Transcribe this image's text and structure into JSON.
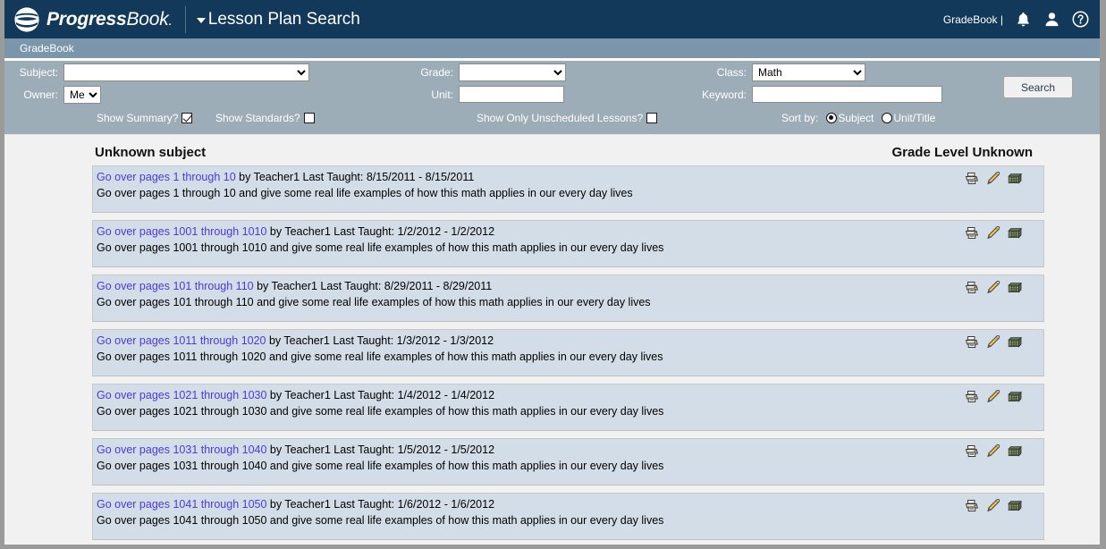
{
  "header": {
    "brand_bold": "Progress",
    "brand_light": "Book",
    "brand_dot": ".",
    "page_title": "Lesson Plan Search",
    "user_label": "GradeBook |",
    "icons": [
      "bell-icon",
      "user-icon",
      "help-icon"
    ],
    "bg_color": "#12395a"
  },
  "tabbar": {
    "tabs": [
      {
        "label": "GradeBook"
      }
    ],
    "bg_color": "#7b95ab"
  },
  "filters": {
    "bg_color": "#9dadb8",
    "subject": {
      "label": "Subject:",
      "value": "",
      "options": [
        ""
      ]
    },
    "owner": {
      "label": "Owner:",
      "value": "Me",
      "options": [
        "Me"
      ]
    },
    "grade": {
      "label": "Grade:",
      "value": "",
      "options": [
        ""
      ]
    },
    "unit": {
      "label": "Unit:",
      "value": "",
      "placeholder": ""
    },
    "class": {
      "label": "Class:",
      "value": "Math",
      "options": [
        "Math"
      ]
    },
    "keyword": {
      "label": "Keyword:",
      "value": "",
      "placeholder": ""
    },
    "search_button": "Search",
    "show_summary": {
      "label": "Show Summary?",
      "checked": true
    },
    "show_standards": {
      "label": "Show Standards?",
      "checked": false
    },
    "show_only_unscheduled": {
      "label": "Show Only Unscheduled Lessons?",
      "checked": false
    },
    "sort_by": {
      "label": "Sort by:",
      "options": [
        {
          "label": "Subject",
          "selected": true
        },
        {
          "label": "Unit/Title",
          "selected": false
        }
      ]
    }
  },
  "results": {
    "subject_heading": "Unknown subject",
    "grade_level_heading": "Grade Level Unknown",
    "row_bg_color": "#d3dde7",
    "link_color": "#4b3ad6",
    "row_icons": [
      "print-icon",
      "edit-icon",
      "schedule-icon"
    ],
    "lessons": [
      {
        "link_prefix": "Go over pages ",
        "link_range": "1 through 10",
        "meta": " by Teacher1 Last Taught: 8/15/2011 - 8/15/2011",
        "description": "Go over pages 1 through 10 and give some real life examples of how this math applies in our every day lives"
      },
      {
        "link_prefix": "Go over pages ",
        "link_range": "1001 through 1010",
        "meta": " by Teacher1 Last Taught: 1/2/2012 - 1/2/2012",
        "description": "Go over pages 1001 through 1010 and give some real life examples of how this math applies in our every day lives"
      },
      {
        "link_prefix": "Go over pages ",
        "link_range": "101 through 110",
        "meta": " by Teacher1 Last Taught: 8/29/2011 - 8/29/2011",
        "description": "Go over pages 101 through 110 and give some real life examples of how this math applies in our every day lives"
      },
      {
        "link_prefix": "Go over pages ",
        "link_range": "1011 through 1020",
        "meta": " by Teacher1 Last Taught: 1/3/2012 - 1/3/2012",
        "description": "Go over pages 1011 through 1020 and give some real life examples of how this math applies in our every day lives"
      },
      {
        "link_prefix": "Go over pages ",
        "link_range": "1021 through 1030",
        "meta": " by Teacher1 Last Taught: 1/4/2012 - 1/4/2012",
        "description": "Go over pages 1021 through 1030 and give some real life examples of how this math applies in our every day lives"
      },
      {
        "link_prefix": "Go over pages ",
        "link_range": "1031 through 1040",
        "meta": " by Teacher1 Last Taught: 1/5/2012 - 1/5/2012",
        "description": "Go over pages 1031 through 1040 and give some real life examples of how this math applies in our every day lives"
      },
      {
        "link_prefix": "Go over pages ",
        "link_range": "1041 through 1050",
        "meta": " by Teacher1 Last Taught: 1/6/2012 - 1/6/2012",
        "description": "Go over pages 1041 through 1050 and give some real life examples of how this math applies in our every day lives"
      }
    ]
  }
}
